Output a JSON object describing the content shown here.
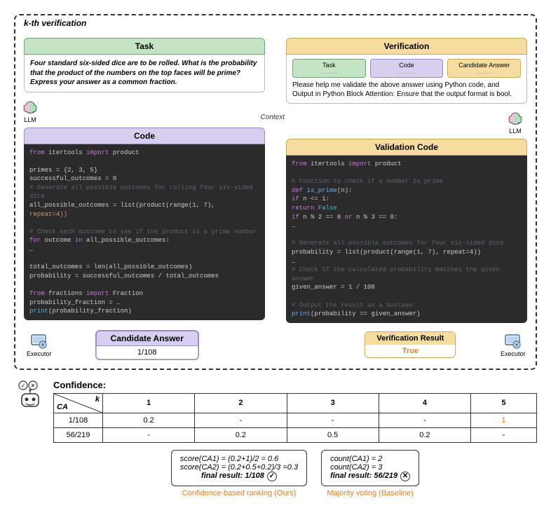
{
  "kth_label": "k-th verification",
  "task": {
    "title": "Task",
    "text": "Four standard six-sided dice are to be rolled. What is the probability that the product of the numbers on the top faces will be prime? Express your answer as a common fraction."
  },
  "code": {
    "title": "Code",
    "lines": {
      "l1a": "from",
      "l1b": " itertools ",
      "l1c": "import",
      "l1d": " product",
      "l2": "primes = {2, 3, 5}",
      "l3": "successful_outcomes = 0",
      "c1": "# Generate all possible outcomes for rolling four six-sided dice",
      "l4": "all_possible_outcomes = list(product(range(1, 7),",
      "l4b": "repeat=4))",
      "c2": "# Check each outcome to see if the product is a prime number",
      "l5a": "for",
      "l5b": " outcome ",
      "l5c": "in",
      "l5d": " all_possible_outcomes:",
      "l6": "    …",
      "l7": "total_outcomes = len(all_possible_outcomes)",
      "l8": "probability = successful_outcomes / total_outcomes",
      "l9a": "from",
      "l9b": " fractions ",
      "l9c": "import",
      "l9d": " Fraction",
      "l10": "probability_fraction = …",
      "l11a": "print",
      "l11b": "(probability_fraction)"
    }
  },
  "candidate": {
    "title": "Candidate Answer",
    "value": "1/108"
  },
  "verification": {
    "title": "Verification",
    "mini_task": "Task",
    "mini_code": "Code",
    "mini_cand": "Candidate Answer",
    "dots": "………",
    "prompt": "Please help me validate the above answer using Python code, and Output in Python Block Attention: Ensure that the output format is bool."
  },
  "validation_code": {
    "title": "Validation Code",
    "lines": {
      "l1a": "from",
      "l1b": " itertools ",
      "l1c": "import",
      "l1d": " product",
      "c1": "# Function to check if a number is prime",
      "l2a": "def ",
      "l2b": "is_prime",
      "l2c": "(n):",
      "l3a": "    if",
      "l3b": " n <= 1:",
      "l4a": "        return ",
      "l4b": "False",
      "l5a": "    if",
      "l5b": " n % 2 == 0 ",
      "l5c": "or",
      "l5d": " n % 3 == 0:",
      "l6": "    …",
      "c2": "# Generate all possible outcomes for four six-sided dice",
      "l7": "probability = list(product(range(1, 7), repeat=4))",
      "l8": "…",
      "c3": "# Check if the calculated probability matches the given answer",
      "l9": "given_answer = 1 / 108",
      "c4": "# Output the result as a boolean",
      "l10a": "print",
      "l10b": "(probability == given_answer)"
    }
  },
  "verif_result": {
    "title": "Verification Result",
    "value": "True"
  },
  "labels": {
    "llm": "LLM",
    "executor": "Executor",
    "context": "Context"
  },
  "confidence": {
    "title": "Confidence:",
    "k_label": "k",
    "ca_label": "CA",
    "columns": [
      "1",
      "2",
      "3",
      "4",
      "5"
    ],
    "rows": [
      {
        "ca": "1/108",
        "vals": [
          "0.2",
          "-",
          "-",
          "-",
          "1"
        ],
        "highlight_idx": 4
      },
      {
        "ca": "56/219",
        "vals": [
          "-",
          "0.2",
          "0.5",
          "0.2",
          "-"
        ]
      }
    ]
  },
  "scores": {
    "ours": {
      "l1": "score(CA1) = (0.2+1)/2 = 0.6",
      "l2": "score(CA2) = (0.2+0.5+0.2)/3 =0.3",
      "final_label": "final result:",
      "final_value": "1/108",
      "mark": "✓",
      "method": "Confidence-based ranking  (Ours)"
    },
    "baseline": {
      "l1": "count(CA1) = 2",
      "l2": "count(CA2) = 3",
      "final_label": "final result:",
      "final_value": "56/219",
      "mark": "✕",
      "method": "Majority voting (Baseline)"
    }
  }
}
